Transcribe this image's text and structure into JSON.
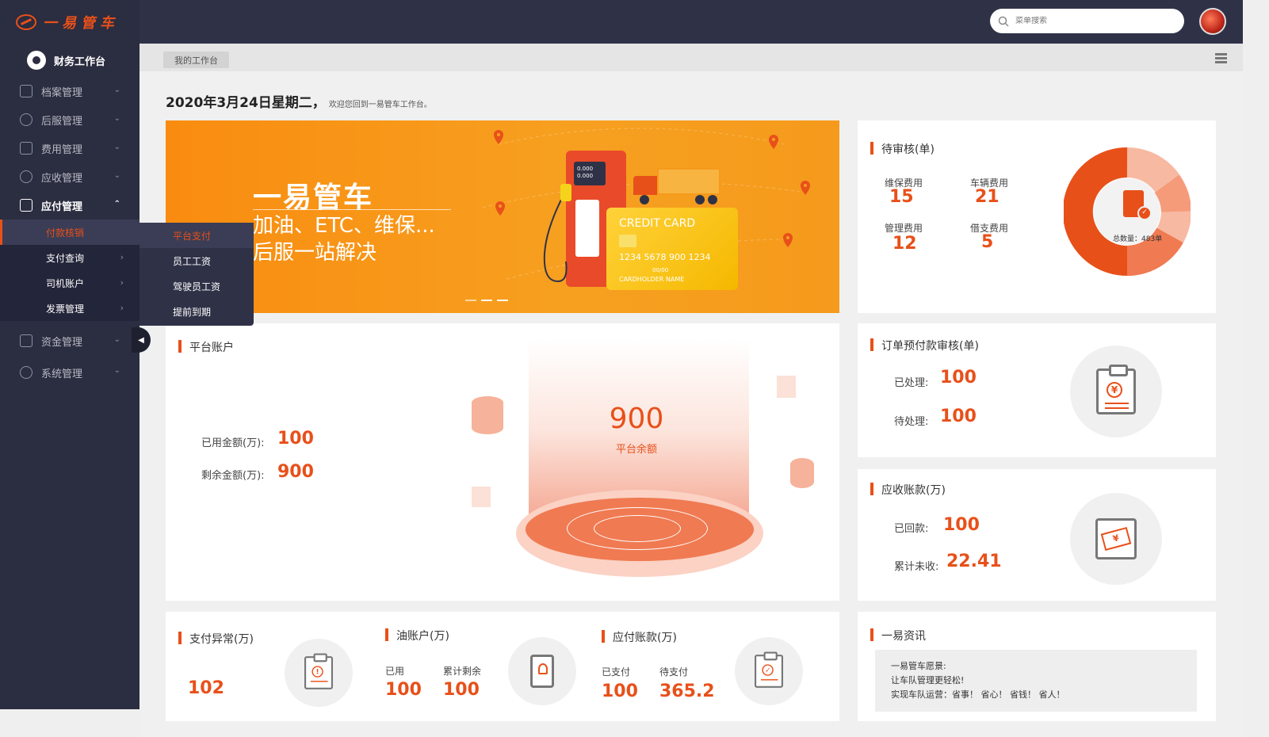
{
  "app": {
    "logo_text": "一易管车"
  },
  "search": {
    "placeholder": "菜单搜索"
  },
  "sidebar": {
    "workspace": "财务工作台",
    "items": [
      {
        "label": "档案管理"
      },
      {
        "label": "后服管理"
      },
      {
        "label": "费用管理"
      },
      {
        "label": "应收管理"
      },
      {
        "label": "应付管理"
      }
    ],
    "sub_items": [
      {
        "label": "付款核销"
      },
      {
        "label": "支付查询"
      },
      {
        "label": "司机账户"
      },
      {
        "label": "发票管理"
      }
    ],
    "items_after": [
      {
        "label": "资金管理"
      },
      {
        "label": "系统管理"
      }
    ],
    "flyout": [
      {
        "label": "平台支付"
      },
      {
        "label": "员工工资"
      },
      {
        "label": "驾驶员工资"
      },
      {
        "label": "提前到期"
      }
    ]
  },
  "tabs": {
    "current": "我的工作台"
  },
  "greeting": {
    "date": "2020年3月24日星期二，",
    "welcome": "欢迎您回到一易管车工作台。"
  },
  "banner": {
    "title": "一易管车",
    "line1": "加油、ETC、维保...",
    "line2": "后服一站解决",
    "card_title": "CREDIT CARD",
    "card_number": "1234 5678 900 1234",
    "card_exp": "00/00",
    "card_name": "CARDHOLDER NAME",
    "pump_reading1": "0.000",
    "pump_reading2": "0.000"
  },
  "pending": {
    "title": "待审核(单)",
    "items": [
      {
        "label": "维保费用",
        "value": "15"
      },
      {
        "label": "车辆费用",
        "value": "21"
      },
      {
        "label": "管理费用",
        "value": "12"
      },
      {
        "label": "借支费用",
        "value": "5"
      }
    ],
    "total_label": "总数量：",
    "total_value": "483单"
  },
  "order_prepay": {
    "title": "订单预付款审核(单)",
    "processed_label": "已处理:",
    "processed_value": "100",
    "pending_label": "待处理:",
    "pending_value": "100"
  },
  "platform": {
    "title": "平台账户",
    "used_label": "已用金额(万):",
    "used_value": "100",
    "remain_label": "剩余金额(万):",
    "remain_value": "900",
    "balance_value": "900",
    "balance_label": "平台余额"
  },
  "receivable": {
    "title": "应收账款(万)",
    "returned_label": "已回款:",
    "returned_value": "100",
    "unreceived_label": "累计未收:",
    "unreceived_value": "22.41"
  },
  "payment_abnormal": {
    "title": "支付异常(万)",
    "value": "102"
  },
  "fuel": {
    "title": "油账户(万)",
    "used_label": "已用",
    "used_value": "100",
    "remain_label": "累计剩余",
    "remain_value": "100"
  },
  "payable": {
    "title": "应付账款(万)",
    "paid_label": "已支付",
    "paid_value": "100",
    "topay_label": "待支付",
    "topay_value": "365.2"
  },
  "news": {
    "title": "一易资讯",
    "line1": "一易管车愿景:",
    "line2": "让车队管理更轻松!",
    "line3": "实现车队运营：省事！ 省心！ 省钱！ 省人！"
  },
  "colors": {
    "accent": "#e8501a",
    "sidebar": "#2b2d40",
    "topbar": "#2f3247"
  }
}
